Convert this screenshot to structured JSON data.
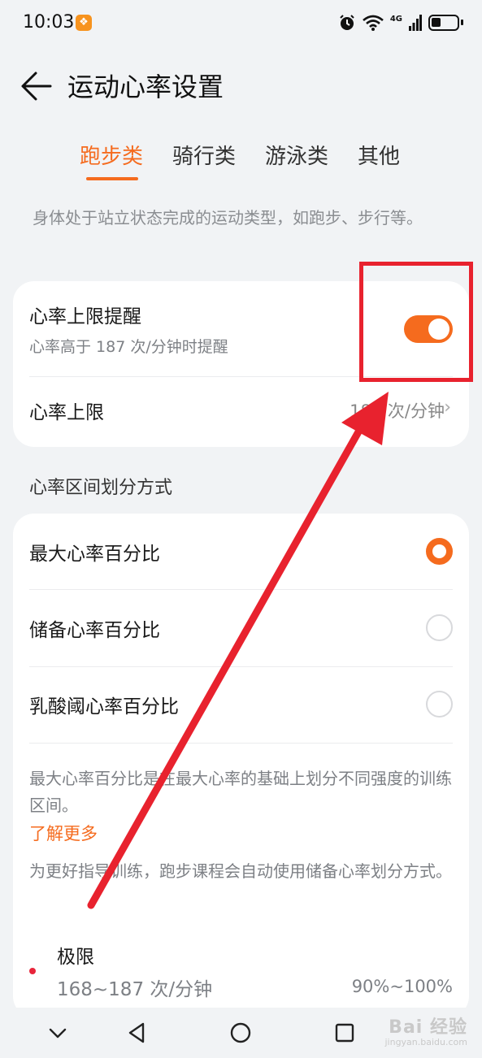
{
  "status_bar": {
    "time": "10:03",
    "network": "4G",
    "icons": [
      "app-notification-icon",
      "alarm-icon",
      "wifi-icon",
      "signal-icon",
      "battery-icon"
    ]
  },
  "header": {
    "title": "运动心率设置"
  },
  "tabs": [
    {
      "label": "跑步类",
      "active": true
    },
    {
      "label": "骑行类",
      "active": false
    },
    {
      "label": "游泳类",
      "active": false
    },
    {
      "label": "其他",
      "active": false
    }
  ],
  "description": "身体处于站立状态完成的运动类型，如跑步、步行等。",
  "alert_card": {
    "upper_alert_title": "心率上限提醒",
    "upper_alert_subtitle": "心率高于 187 次/分钟时提醒",
    "upper_alert_enabled": true,
    "upper_limit_title": "心率上限",
    "upper_limit_value": "187 次/分钟"
  },
  "zone_section": {
    "header": "心率区间划分方式",
    "options": [
      {
        "label": "最大心率百分比",
        "selected": true
      },
      {
        "label": "储备心率百分比",
        "selected": false
      },
      {
        "label": "乳酸阈心率百分比",
        "selected": false
      }
    ],
    "explanation": "最大心率百分比是在最大心率的基础上划分不同强度的训练区间。",
    "learn_more": "了解更多",
    "note": "为更好指导训练，跑步课程会自动使用储备心率划分方式。",
    "zones": [
      {
        "name": "极限",
        "range": "168~187 次/分钟",
        "percent": "90%~100%",
        "color": "#e8253b"
      }
    ]
  },
  "colors": {
    "accent": "#f56b1e",
    "annotation_red": "#e8222e"
  },
  "watermark": {
    "main": "Bai 经验",
    "sub": "jingyan.baidu.com"
  }
}
